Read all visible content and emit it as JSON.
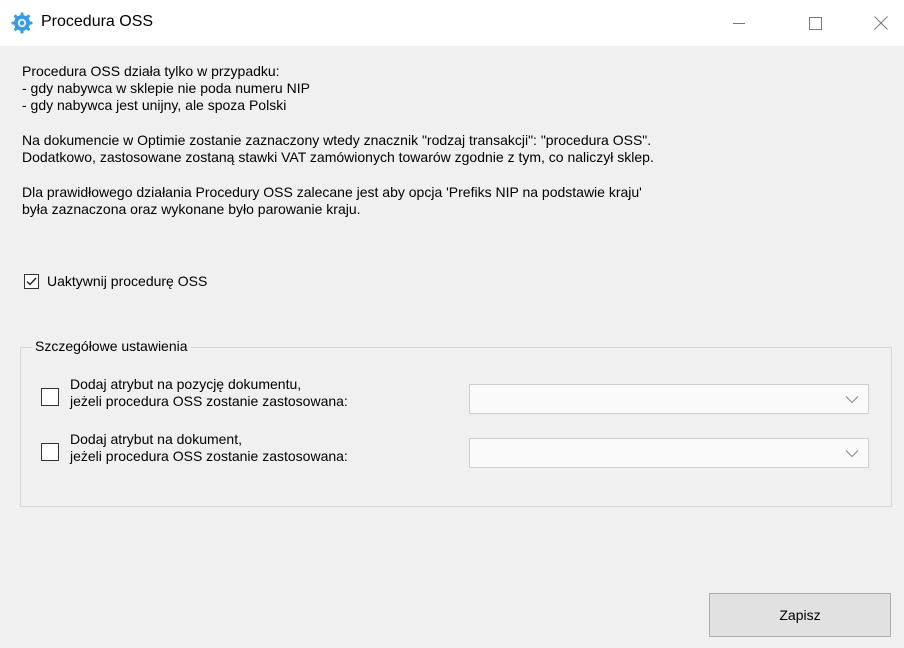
{
  "window": {
    "title": "Procedura OSS",
    "icon": "oss-gear-icon"
  },
  "info": {
    "lines": [
      "Procedura OSS działa tylko w przypadku:",
      "- gdy nabywca w sklepie nie poda numeru NIP",
      "- gdy nabywca jest unijny, ale spoza Polski",
      "Na dokumencie w Optimie zostanie zaznaczony wtedy znacznik \"rodzaj transakcji\": \"procedura OSS\".",
      "Dodatkowo, zastosowane zostaną stawki VAT zamówionych towarów zgodnie z tym, co naliczył sklep.",
      "Dla prawidłowego działania Procedury OSS zalecane jest aby opcja 'Prefiks NIP na podstawie kraju'",
      "była zaznaczona oraz wykonane było parowanie kraju."
    ]
  },
  "activate": {
    "label": "Uaktywnij procedurę OSS",
    "checked": true
  },
  "details": {
    "legend": "Szczegółowe ustawienia",
    "options": [
      {
        "line1": "Dodaj atrybut na pozycję dokumentu,",
        "line2": "jeżeli procedura OSS zostanie zastosowana:",
        "checked": false,
        "selected": ""
      },
      {
        "line1": "Dodaj atrybut na dokument,",
        "line2": "jeżeli procedura OSS zostanie zastosowana:",
        "checked": false,
        "selected": ""
      }
    ]
  },
  "footer": {
    "save_label": "Zapisz"
  },
  "colors": {
    "window_bg": "#f0f0f0",
    "titlebar_bg": "#ffffff",
    "icon_blue": "#3a9be0",
    "button_bg": "#e1e1e1"
  }
}
